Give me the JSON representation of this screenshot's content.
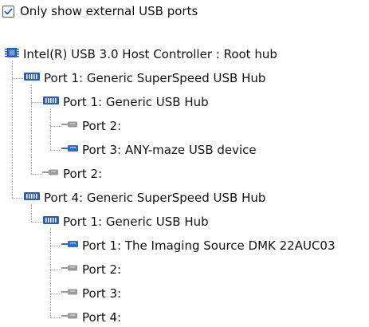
{
  "filter": {
    "label": "Only show external USB ports",
    "checked": true
  },
  "tree": {
    "items": [
      {
        "label": "Intel(R) USB 3.0 Host Controller : Root hub",
        "icon": "usb-controller-icon",
        "depth": 0
      },
      {
        "label": "Port 1: Generic SuperSpeed USB Hub",
        "icon": "usb-hub-icon",
        "depth": 1
      },
      {
        "label": "Port 1: Generic USB Hub",
        "icon": "usb-hub-icon",
        "depth": 2
      },
      {
        "label": "Port 2:",
        "icon": "usb-port-empty-icon",
        "depth": 3
      },
      {
        "label": "Port 3: ANY-maze USB device",
        "icon": "usb-device-connected-icon",
        "depth": 3
      },
      {
        "label": "Port 2:",
        "icon": "usb-port-empty-icon",
        "depth": 2
      },
      {
        "label": "Port 4: Generic SuperSpeed USB Hub",
        "icon": "usb-hub-icon",
        "depth": 1
      },
      {
        "label": "Port 1: Generic USB Hub",
        "icon": "usb-hub-icon",
        "depth": 2
      },
      {
        "label": "Port 1: The Imaging Source DMK 22AUC03",
        "icon": "usb-device-connected-icon",
        "depth": 3
      },
      {
        "label": "Port 2:",
        "icon": "usb-port-empty-icon",
        "depth": 3
      },
      {
        "label": "Port 3:",
        "icon": "usb-port-empty-icon",
        "depth": 3
      },
      {
        "label": "Port 4:",
        "icon": "usb-port-empty-icon",
        "depth": 3
      }
    ]
  },
  "colors": {
    "hub": "#2e5fa8",
    "device": "#2e6fc0",
    "empty": "#9a9a9a",
    "chip": "#2a5db0"
  }
}
